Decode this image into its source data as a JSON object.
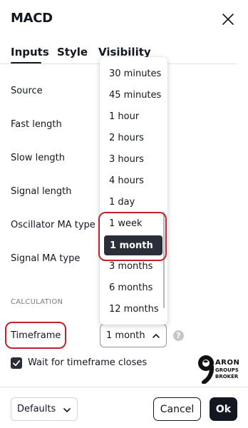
{
  "dialog": {
    "title": "MACD",
    "close_icon": "close-icon"
  },
  "tabs": [
    {
      "label": "Inputs",
      "active": true
    },
    {
      "label": "Style",
      "active": false
    },
    {
      "label": "Visibility",
      "active": false
    }
  ],
  "inputs": {
    "source_label": "Source",
    "fast_length_label": "Fast length",
    "slow_length_label": "Slow length",
    "signal_length_label": "Signal length",
    "oscillator_ma_type_label": "Oscillator MA type",
    "signal_ma_type_label": "Signal MA type"
  },
  "calculation": {
    "section_title": "CALCULATION",
    "timeframe_label": "Timeframe",
    "timeframe_value": "1 month",
    "help_glyph": "?",
    "wait_checkbox_label": "Wait for timeframe closes",
    "wait_checked": true
  },
  "timeframe_dropdown": {
    "options": [
      "30 minutes",
      "45 minutes",
      "1 hour",
      "2 hours",
      "3 hours",
      "4 hours",
      "1 day",
      "1 week",
      "1 month",
      "3 months",
      "6 months",
      "12 months"
    ],
    "selected": "1 month"
  },
  "logo": {
    "digit": "9",
    "line1": "ARON",
    "line2": "GROUPS",
    "line3": "BROKER"
  },
  "footer": {
    "defaults_label": "Defaults",
    "cancel_label": "Cancel",
    "ok_label": "Ok"
  },
  "colors": {
    "text": "#131722",
    "highlight_red": "#c0232b",
    "selected_bg": "#2a2e39",
    "muted": "#787b86"
  }
}
